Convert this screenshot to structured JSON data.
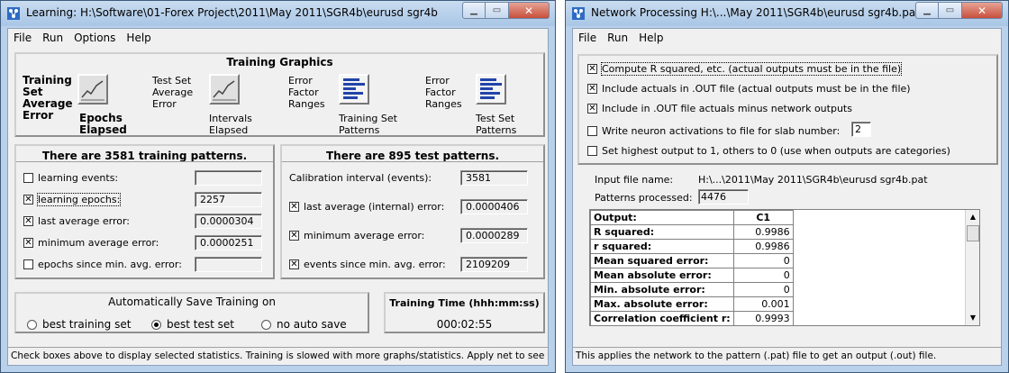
{
  "learning": {
    "title": "Learning: H:\\Software\\01-Forex Project\\2011\\May 2011\\SGR4b\\eurusd sgr4b",
    "menu": [
      "File",
      "Run",
      "Options",
      "Help"
    ],
    "graphics": {
      "heading": "Training Graphics",
      "training_label": [
        "Training",
        "Set",
        "Average",
        "Error"
      ],
      "epochs_elapsed": [
        "Epochs",
        "Elapsed"
      ],
      "test_label": [
        "Test Set",
        "Average",
        "Error"
      ],
      "intervals_elapsed": [
        "Intervals",
        "Elapsed"
      ],
      "error_factor_1": [
        "Error",
        "Factor",
        "Ranges"
      ],
      "training_set_patterns": [
        "Training Set",
        "Patterns"
      ],
      "error_factor_2": [
        "Error",
        "Factor",
        "Ranges"
      ],
      "test_set_patterns": [
        "Test Set",
        "Patterns"
      ]
    },
    "training_panel": {
      "heading": "There are 3581 training patterns.",
      "rows": [
        {
          "label": "learning events:",
          "checked": false,
          "value": ""
        },
        {
          "label": "learning epochs:",
          "checked": true,
          "value": "2257"
        },
        {
          "label": "last average error:",
          "checked": true,
          "value": "0.0000304"
        },
        {
          "label": "minimum average error:",
          "checked": true,
          "value": "0.0000251"
        },
        {
          "label": "epochs since min. avg. error:",
          "checked": false,
          "value": ""
        }
      ]
    },
    "test_panel": {
      "heading": "There are 895 test patterns.",
      "calibration_label": "Calibration interval (events):",
      "calibration_value": "3581",
      "rows": [
        {
          "label": "last average (internal) error:",
          "checked": true,
          "value": "0.0000406"
        },
        {
          "label": "minimum average error:",
          "checked": true,
          "value": "0.0000289"
        },
        {
          "label": "events since min. avg. error:",
          "checked": true,
          "value": "2109209"
        }
      ]
    },
    "autosave": {
      "heading": "Automatically Save Training on",
      "options": [
        "best training set",
        "best test set",
        "no auto save"
      ],
      "selected": "best test set"
    },
    "training_time": {
      "heading": "Training Time (hhh:mm:ss)",
      "value": "000:02:55"
    },
    "status": "Check boxes above to display selected statistics. Training is slowed with more graphs/statistics. Apply net to see true error."
  },
  "network": {
    "title": "Network Processing H:\\...\\May 2011\\SGR4b\\eurusd sgr4b.pat",
    "menu": [
      "File",
      "Run",
      "Help"
    ],
    "options": [
      {
        "label": "Compute R squared, etc. (actual outputs must be in the file)",
        "checked": true
      },
      {
        "label": "Include actuals in .OUT file (actual outputs must be in the file)",
        "checked": true
      },
      {
        "label": "Include in .OUT file actuals minus network outputs",
        "checked": true
      },
      {
        "label": "Write neuron activations to file for slab number:",
        "checked": false
      },
      {
        "label": "Set highest output to 1, others to 0 (use when outputs are categories)",
        "checked": false
      }
    ],
    "slab_number": "2",
    "input_file_label": "Input file name:",
    "input_file_value": "H:\\...\\2011\\May 2011\\SGR4b\\eurusd sgr4b.pat",
    "patterns_label": "Patterns processed:",
    "patterns_value": "4476",
    "table": {
      "header": [
        "Output:",
        "C1"
      ],
      "rows": [
        [
          "R squared:",
          "0.9986"
        ],
        [
          "r squared:",
          "0.9986"
        ],
        [
          "Mean squared error:",
          "0"
        ],
        [
          "Mean absolute error:",
          "0"
        ],
        [
          "Min. absolute error:",
          "0"
        ],
        [
          "Max. absolute error:",
          "0.001"
        ],
        [
          "Correlation coefficient r:",
          "0.9993"
        ]
      ]
    },
    "status": "This applies the network to the pattern (.pat) file to get an output (.out) file."
  }
}
